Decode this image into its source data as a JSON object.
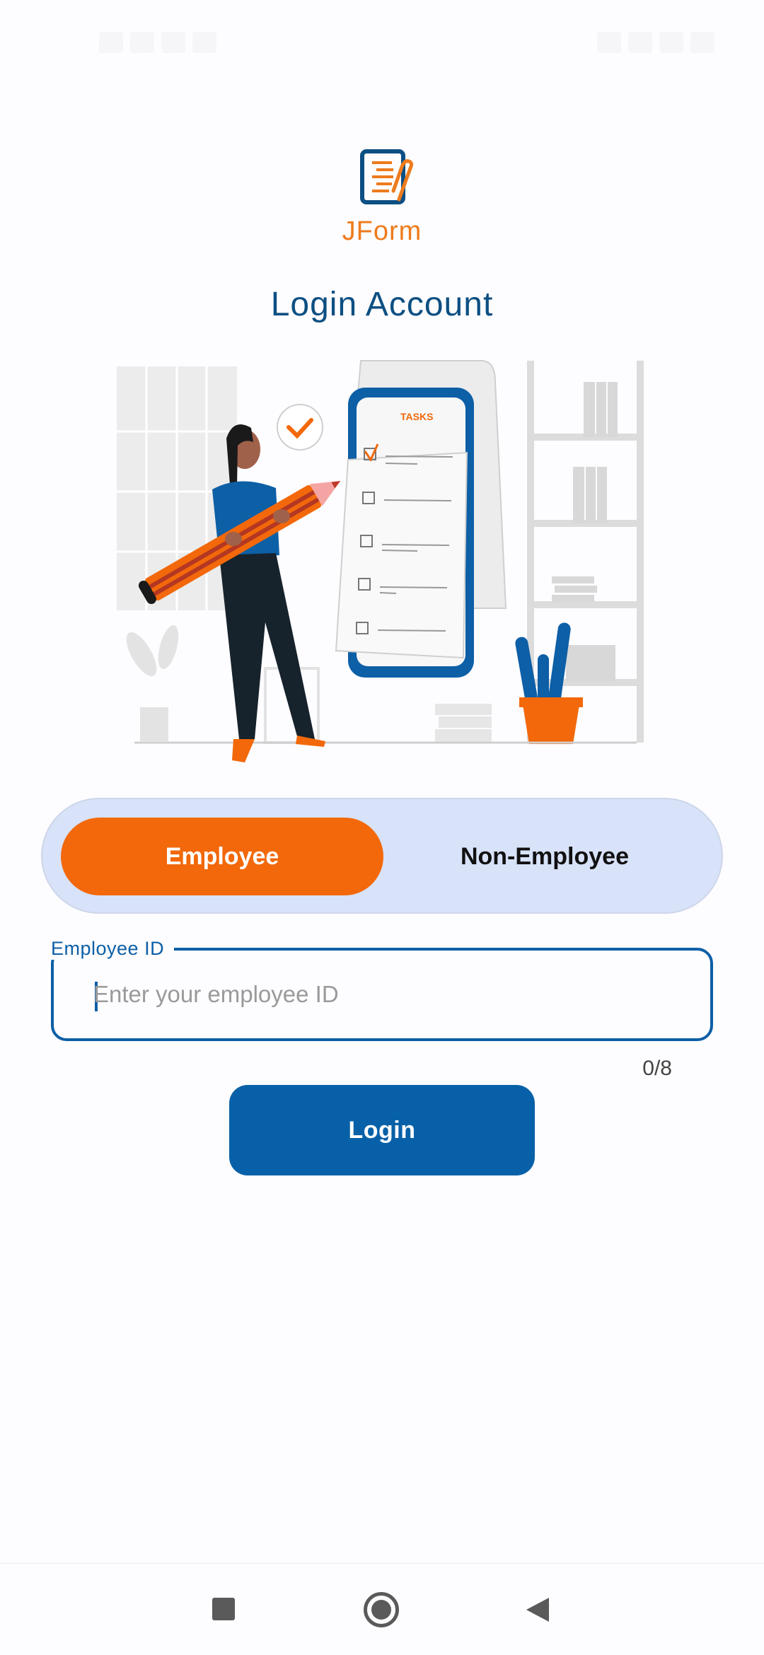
{
  "app": {
    "name": "JForm",
    "title": "Login Account"
  },
  "illustration": {
    "tasks_label": "TASKS"
  },
  "user_type_toggle": {
    "options": [
      "Employee",
      "Non-Employee"
    ],
    "selected": "Employee"
  },
  "employee_id_field": {
    "label": "Employee ID",
    "placeholder": "Enter your employee ID",
    "value": "",
    "counter": "0/8"
  },
  "login_button": {
    "label": "Login"
  },
  "colors": {
    "accent_orange": "#f2680a",
    "primary_blue": "#0861a8",
    "title_blue": "#0c4f82",
    "toggle_bg": "#d8e2f8"
  },
  "icons": {
    "logo": "document-clip-icon",
    "nav_recents": "square-icon",
    "nav_home": "circle-icon",
    "nav_back": "triangle-back-icon"
  }
}
